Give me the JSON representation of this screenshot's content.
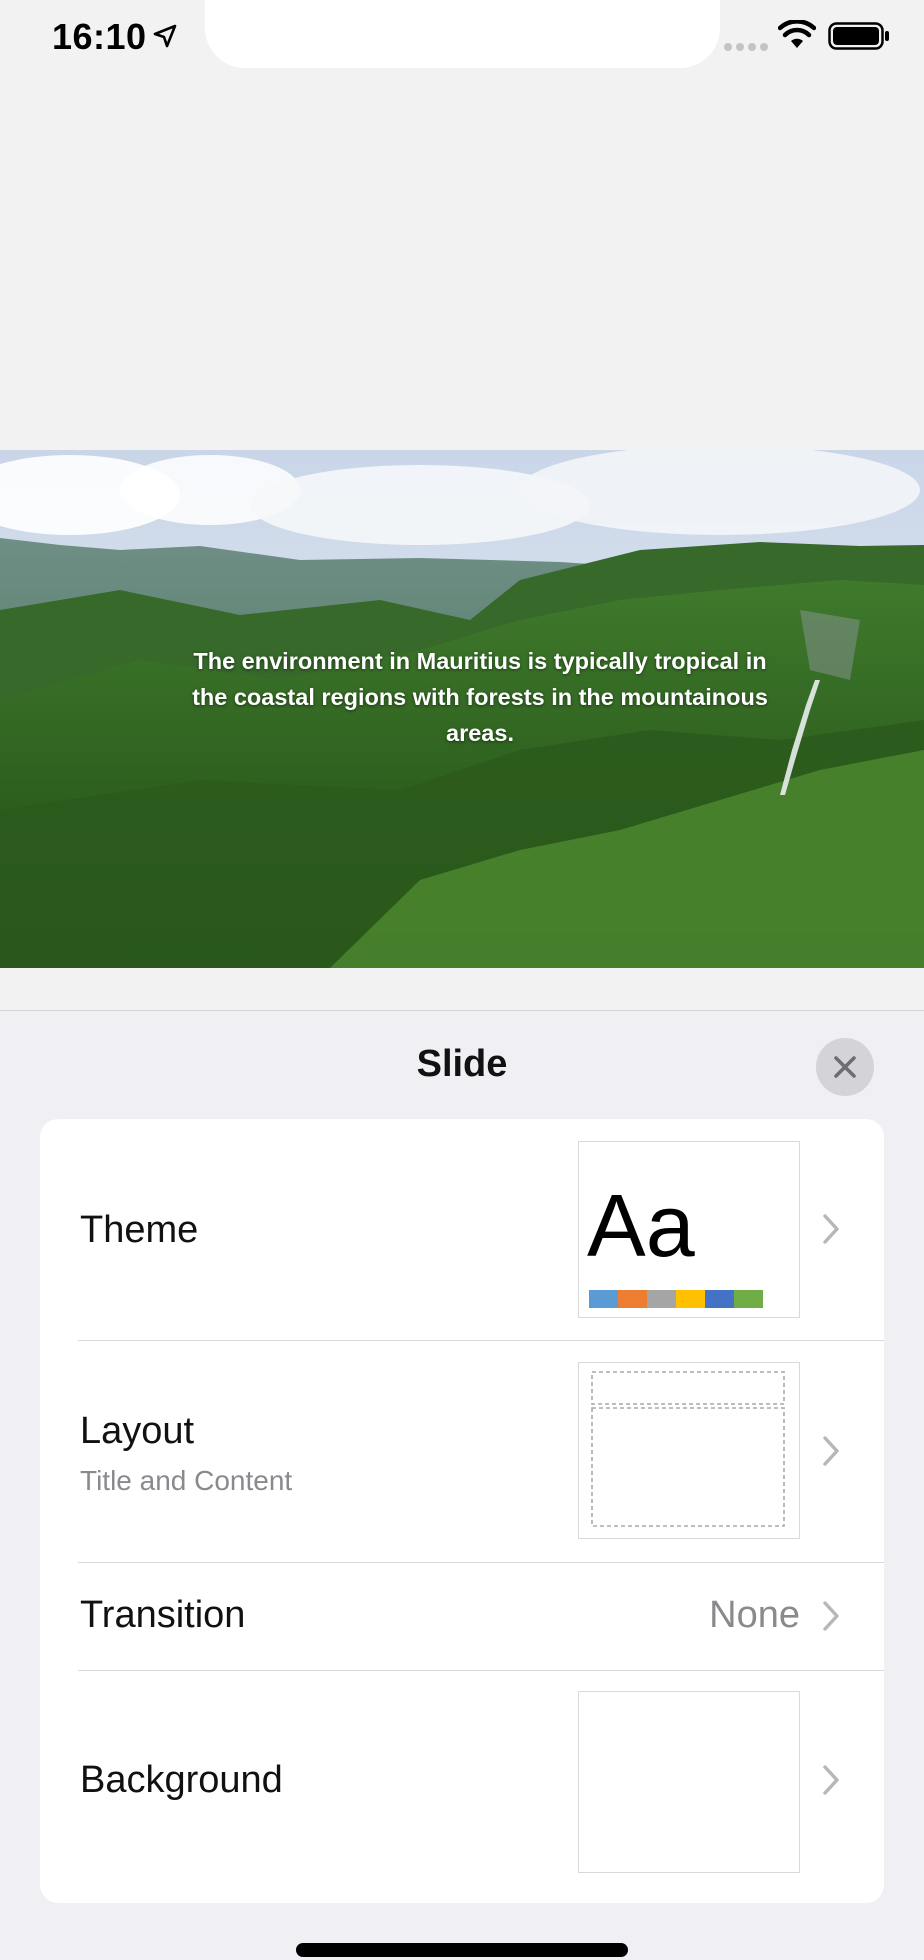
{
  "status_bar": {
    "time": "16:10"
  },
  "slide": {
    "caption": "The environment in Mauritius is typically tropical in the coastal regions with forests in the mountainous areas."
  },
  "sheet": {
    "title": "Slide",
    "rows": [
      {
        "label": "Theme",
        "thumbnail_text": "Aa",
        "swatch_colors": [
          "#5b9bd5",
          "#ed7d31",
          "#a5a5a5",
          "#ffc000",
          "#4472c4",
          "#70ad47"
        ]
      },
      {
        "label": "Layout",
        "subtitle": "Title and Content"
      },
      {
        "label": "Transition",
        "value": "None"
      },
      {
        "label": "Background"
      }
    ]
  },
  "colors": {
    "sheet_background": "#efeff4",
    "card_background": "#ffffff",
    "secondary_text": "#8a8a8e"
  }
}
